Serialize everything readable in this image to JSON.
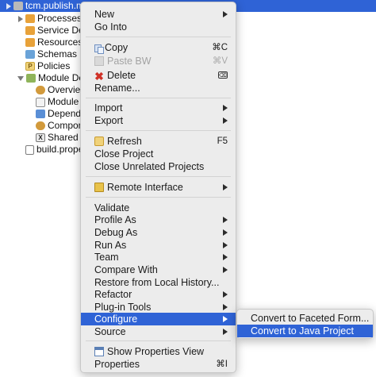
{
  "tree": {
    "project": "tcm.publish.m",
    "items": [
      {
        "label": "Processes"
      },
      {
        "label": "Service De"
      },
      {
        "label": "Resources"
      },
      {
        "label": "Schemas"
      },
      {
        "label": "Policies"
      },
      {
        "label": "Module De"
      },
      {
        "label": "Overview"
      },
      {
        "label": "Module P"
      },
      {
        "label": "Depende"
      },
      {
        "label": "Compon"
      },
      {
        "label": "Shared V"
      },
      {
        "label": "build.prope"
      }
    ]
  },
  "menu": {
    "new": "New",
    "go_into": "Go Into",
    "copy": "Copy",
    "copy_sc": "⌘C",
    "paste": "Paste BW",
    "paste_sc": "⌘V",
    "delete": "Delete",
    "rename": "Rename...",
    "import": "Import",
    "export": "Export",
    "refresh": "Refresh",
    "refresh_sc": "F5",
    "close_project": "Close Project",
    "close_unrelated": "Close Unrelated Projects",
    "remote_interface": "Remote Interface",
    "validate": "Validate",
    "profile_as": "Profile As",
    "debug_as": "Debug As",
    "run_as": "Run As",
    "team": "Team",
    "compare_with": "Compare With",
    "restore_history": "Restore from Local History...",
    "refactor": "Refactor",
    "plugin_tools": "Plug-in Tools",
    "configure": "Configure",
    "source": "Source",
    "show_properties_view": "Show Properties View",
    "properties": "Properties",
    "properties_sc": "⌘I"
  },
  "submenu": {
    "convert_faceted": "Convert to Faceted Form...",
    "convert_java": "Convert to Java Project"
  },
  "colors": {
    "selection": "#2f63d6",
    "menu_bg": "#ececec"
  }
}
